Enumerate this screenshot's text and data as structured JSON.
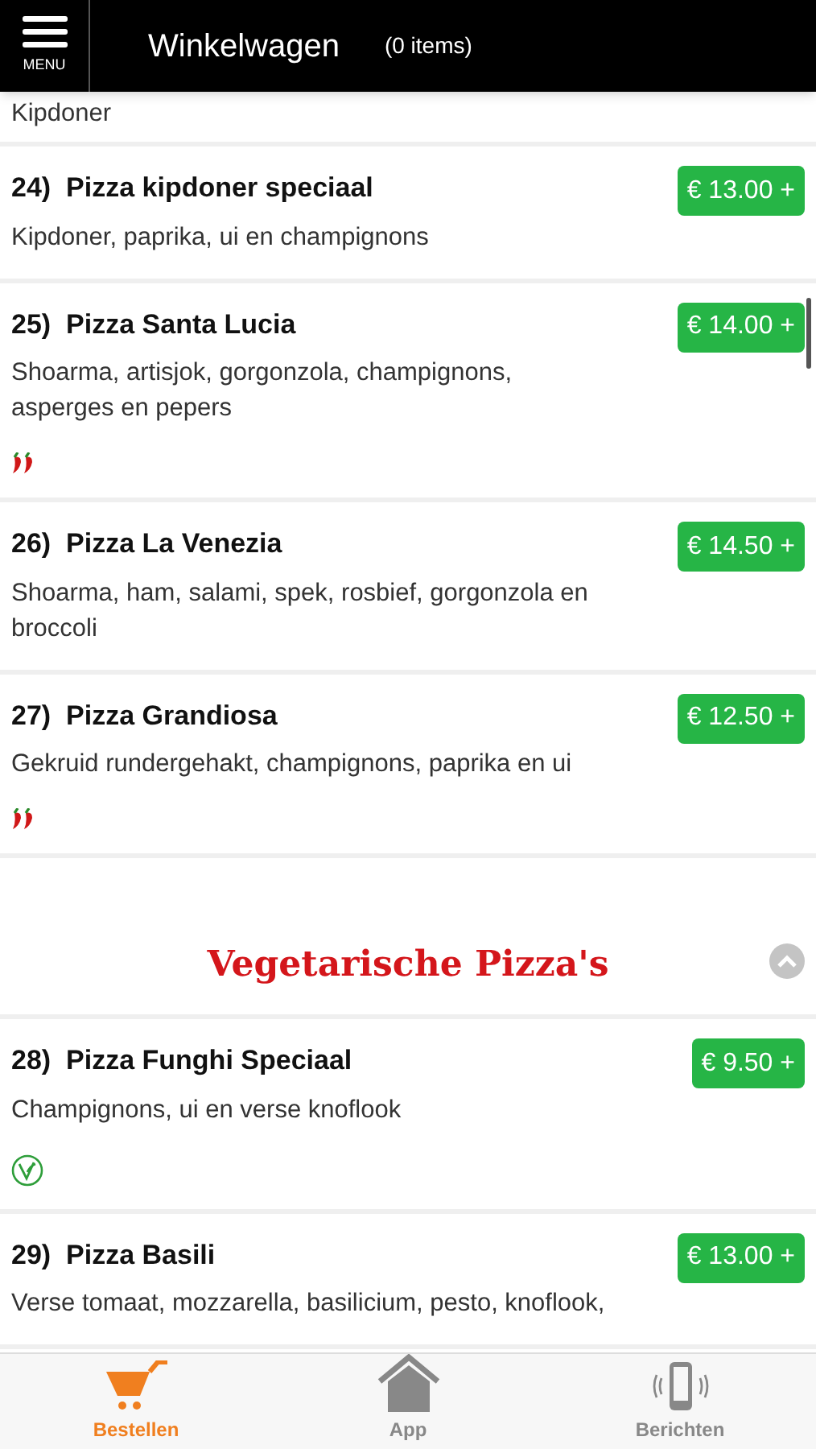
{
  "header": {
    "menu_label": "MENU",
    "title": "Winkelwagen",
    "count": "(0 items)"
  },
  "cut_line": "Kipdoner",
  "menu": [
    {
      "kind": "dish",
      "number": "24)",
      "name": "Pizza kipdoner speciaal",
      "description": "Kipdoner, paprika, ui en champignons",
      "price": "€ 13.00 +"
    },
    {
      "kind": "dish",
      "number": "25)",
      "name": "Pizza Santa Lucia",
      "description": "Shoarma, artisjok, gorgonzola, champignons, asperges en pepers",
      "price": "€ 14.00 +",
      "badges": [
        {
          "kind": "spicy"
        }
      ]
    },
    {
      "kind": "dish",
      "number": "26)",
      "name": "Pizza La Venezia",
      "description": "Shoarma, ham, salami, spek, rosbief, gorgonzola en broccoli",
      "price": "€ 14.50 +"
    },
    {
      "kind": "dish",
      "number": "27)",
      "name": "Pizza Grandiosa",
      "description": "Gekruid rundergehakt, champignons, paprika en ui",
      "price": "€ 12.50 +",
      "badges": [
        {
          "kind": "spicy"
        }
      ]
    },
    {
      "kind": "section",
      "title": "Vegetarische Pizza's"
    },
    {
      "kind": "dish",
      "number": "28)",
      "name": "Pizza Funghi Speciaal",
      "description": "Champignons, ui en verse knoflook",
      "price": "€ 9.50 +",
      "badges": [
        {
          "kind": "vegetarian"
        }
      ]
    },
    {
      "kind": "dish",
      "number": "29)",
      "name": "Pizza Basili",
      "description": "Verse tomaat, mozzarella, basilicium, pesto, knoflook,",
      "price": "€ 13.00 +"
    }
  ],
  "tabs": [
    {
      "label": "Bestellen",
      "kind": "cart",
      "selected": true
    },
    {
      "label": "App",
      "kind": "home",
      "selected": false
    },
    {
      "label": "Berichten",
      "kind": "phone",
      "selected": false
    }
  ]
}
